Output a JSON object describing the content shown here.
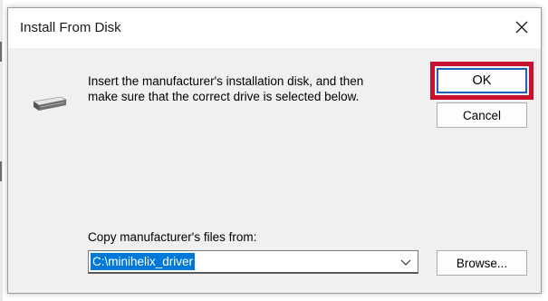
{
  "dialog": {
    "title": "Install From Disk",
    "close_icon": "close-icon",
    "drive_icon": "disk-drive-icon",
    "instructions": {
      "line1": "Insert the manufacturer's installation disk, and then",
      "line2": "make sure that the correct drive is selected below."
    },
    "ok_label": "OK",
    "cancel_label": "Cancel",
    "copy_label": "Copy manufacturer's files from:",
    "path_value": "C:\\minihelix_driver",
    "dropdown_icon": "chevron-down-icon",
    "browse_label": "Browse...",
    "colors": {
      "highlight_frame": "#c8102e",
      "selection": "#0078d7",
      "default_button_border": "#1f5fbf"
    }
  }
}
